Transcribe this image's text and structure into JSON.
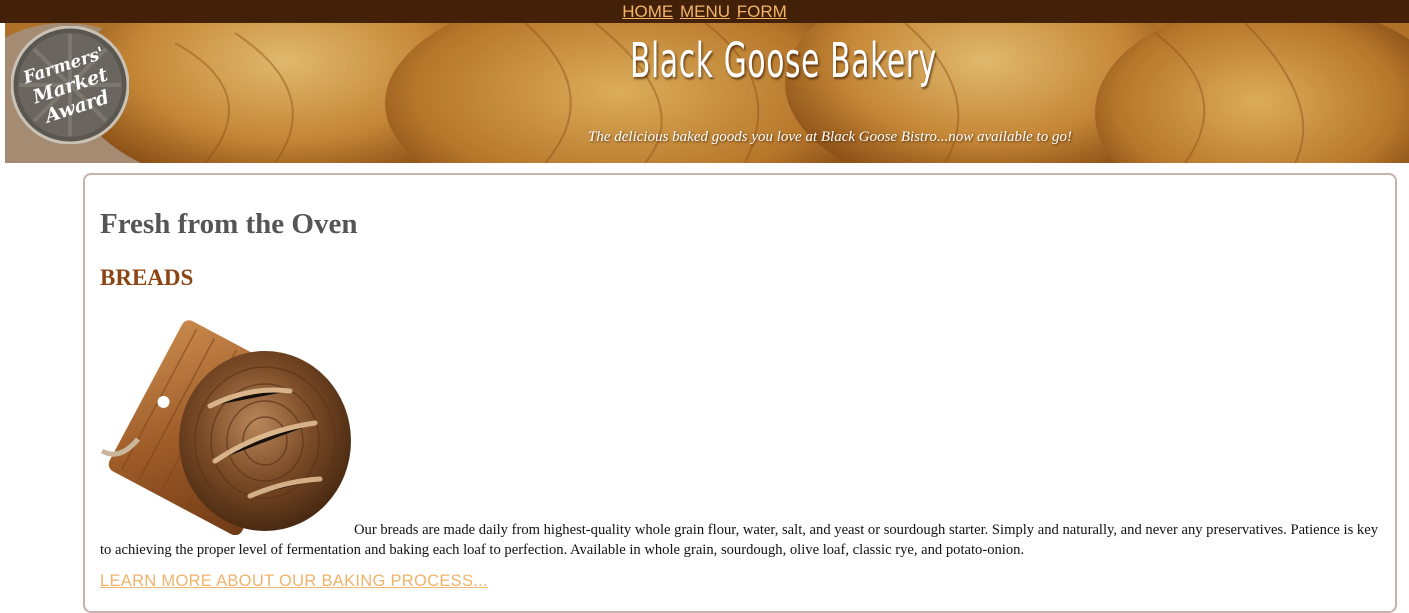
{
  "nav": {
    "items": [
      "HOME",
      "MENU",
      "FORM"
    ]
  },
  "header": {
    "title": "Black Goose Bakery",
    "tagline": "The delicious baked goods you love at Black Goose Bistro...now available to go!",
    "badge": {
      "line1": "Farmers'",
      "line2": "Market",
      "line3": "Award"
    }
  },
  "main": {
    "heading": "Fresh from the Oven",
    "section_title": "BREADS",
    "image_icon": "bread-loaf-on-board",
    "description": "Our breads are made daily from highest-quality whole grain flour, water, salt, and yeast or sourdough starter. Simply and naturally, and never any preservatives. Patience is key to achieving the proper level of fermentation and baking each loaf to perfection. Available in whole grain, sourdough, olive loaf, classic rye, and potato-onion.",
    "learn_more_link": "LEARN MORE ABOUT OUR BAKING PROCESS..."
  },
  "colors": {
    "nav_bg": "#432108",
    "nav_link": "#f5b46a",
    "heading": "#555555",
    "section_title": "#8b4513",
    "link": "#f0b36a",
    "content_border": "#c8b2ad"
  }
}
